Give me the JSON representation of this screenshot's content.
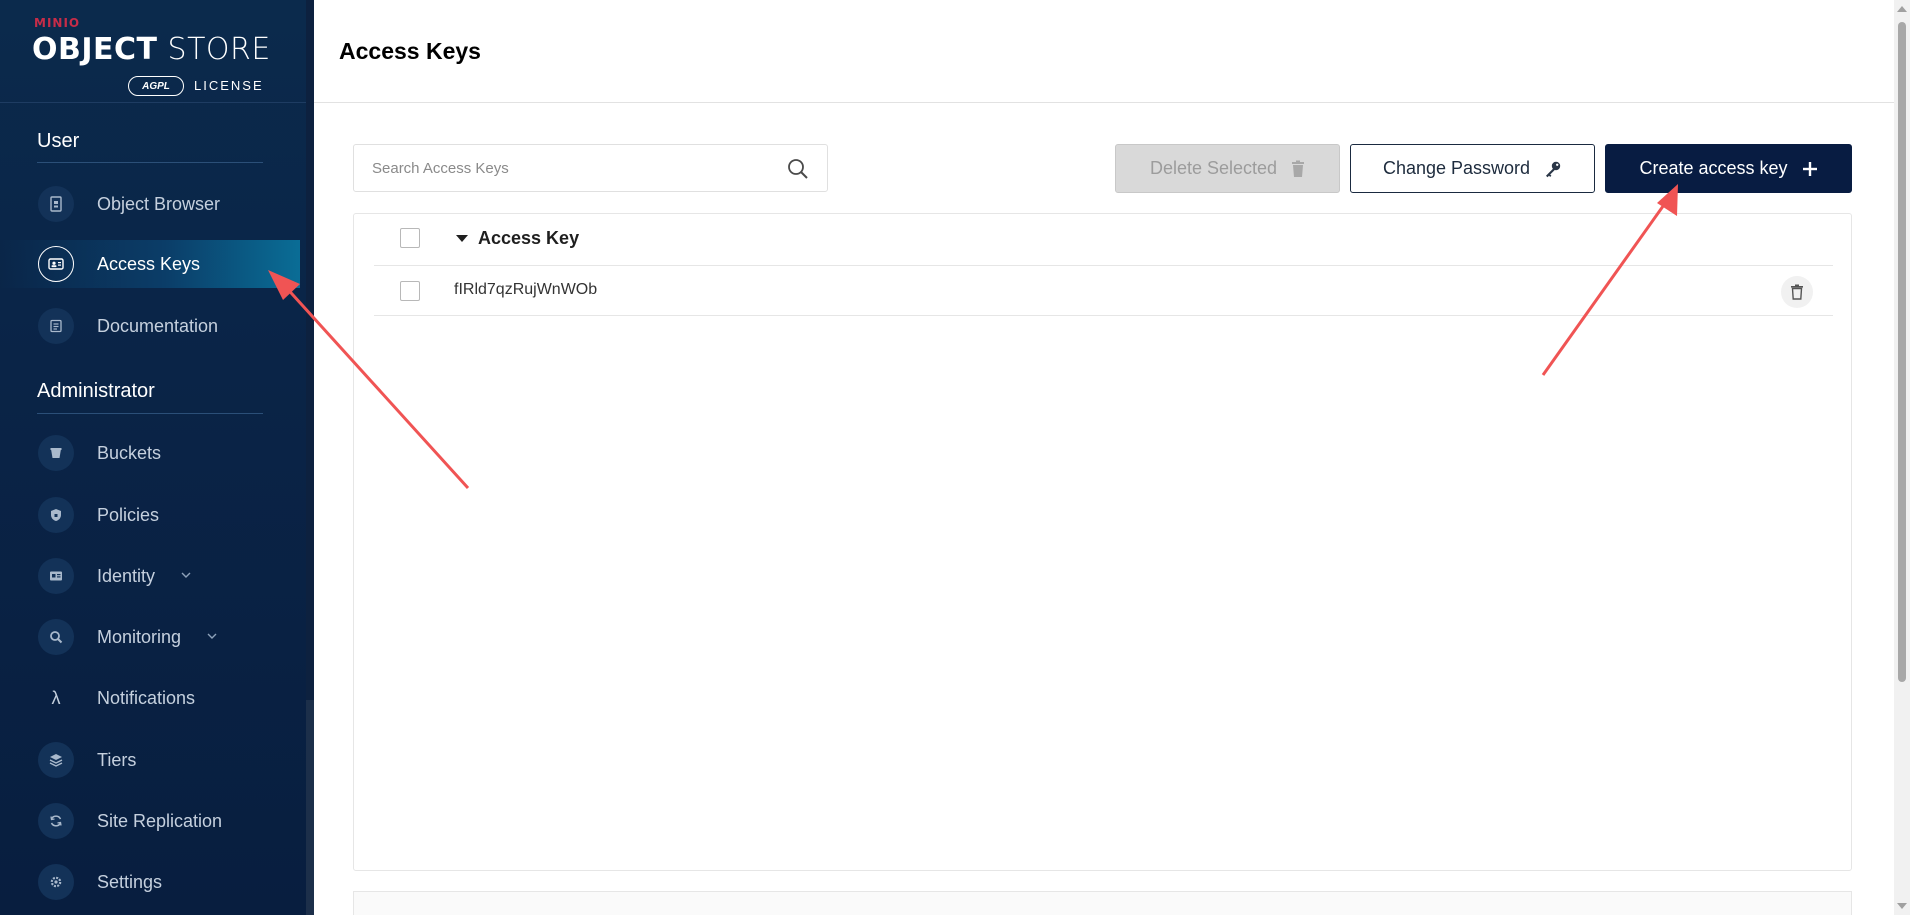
{
  "brand": {
    "top": "MINIO",
    "main_bold": "OBJECT",
    "main_rest": " STORE",
    "badge": "AGPL",
    "license": "LICENSE"
  },
  "sidebar": {
    "sections": [
      {
        "title": "User",
        "items": [
          {
            "label": "Object Browser",
            "icon": "object-browser-icon",
            "active": false
          },
          {
            "label": "Access Keys",
            "icon": "access-keys-icon",
            "active": true
          },
          {
            "label": "Documentation",
            "icon": "documentation-icon",
            "active": false
          }
        ]
      },
      {
        "title": "Administrator",
        "items": [
          {
            "label": "Buckets",
            "icon": "bucket-icon",
            "active": false
          },
          {
            "label": "Policies",
            "icon": "shield-icon",
            "active": false
          },
          {
            "label": "Identity",
            "icon": "identity-card-icon",
            "active": false,
            "expandable": true
          },
          {
            "label": "Monitoring",
            "icon": "magnifier-icon",
            "active": false,
            "expandable": true
          },
          {
            "label": "Notifications",
            "icon": "lambda-icon",
            "active": false
          },
          {
            "label": "Tiers",
            "icon": "layers-icon",
            "active": false
          },
          {
            "label": "Site Replication",
            "icon": "refresh-icon",
            "active": false
          },
          {
            "label": "Settings",
            "icon": "gear-icon",
            "active": false
          }
        ]
      }
    ]
  },
  "header": {
    "title": "Access Keys"
  },
  "toolbar": {
    "search_placeholder": "Search Access Keys",
    "delete_label": "Delete Selected",
    "change_password_label": "Change Password",
    "create_label": "Create access key"
  },
  "table": {
    "column_header": "Access Key",
    "rows": [
      {
        "access_key": "fIRld7qzRujWnWOb"
      }
    ]
  },
  "colors": {
    "sidebar_bg": "#0a2447",
    "primary_button": "#081c42",
    "annotation_arrow": "#f05454"
  }
}
